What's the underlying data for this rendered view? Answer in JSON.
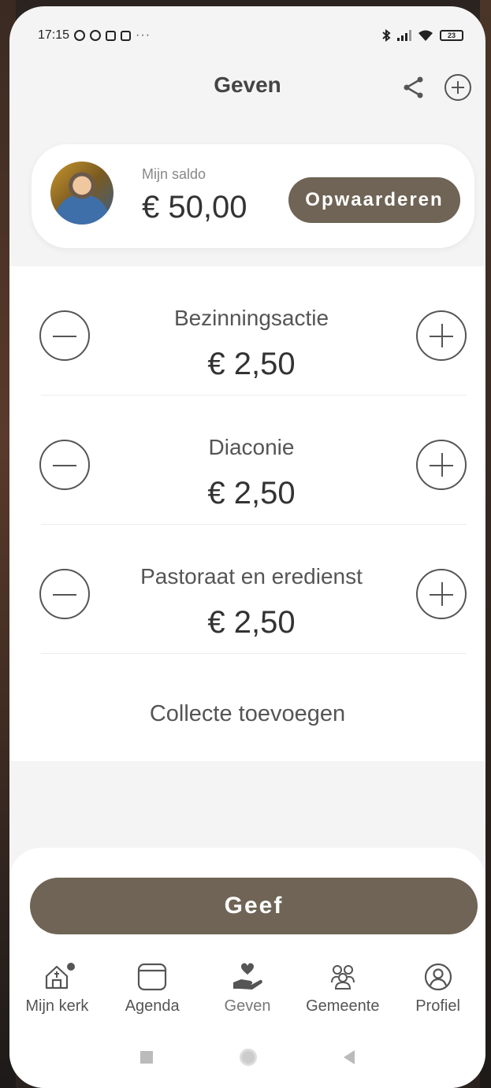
{
  "status": {
    "time": "17:15",
    "dots": "···",
    "battery": "23"
  },
  "header": {
    "title": "Geven"
  },
  "balance": {
    "label": "Mijn saldo",
    "value": "€ 50,00",
    "topup_label": "Opwaarderen"
  },
  "collections": [
    {
      "name": "Bezinningsactie",
      "amount": "€ 2,50"
    },
    {
      "name": "Diaconie",
      "amount": "€ 2,50"
    },
    {
      "name": "Pastoraat en eredienst",
      "amount": "€ 2,50"
    }
  ],
  "add_collection_label": "Collecte toevoegen",
  "give_label": "Geef",
  "nav": {
    "items": [
      {
        "label": "Mijn kerk",
        "icon": "church-home-icon"
      },
      {
        "label": "Agenda",
        "icon": "calendar-icon"
      },
      {
        "label": "Geven",
        "icon": "give-hand-heart-icon"
      },
      {
        "label": "Gemeente",
        "icon": "community-icon"
      },
      {
        "label": "Profiel",
        "icon": "profile-icon"
      }
    ],
    "active": "Geven"
  },
  "colors": {
    "accent": "#6f6455",
    "background": "#f4f4f4"
  }
}
